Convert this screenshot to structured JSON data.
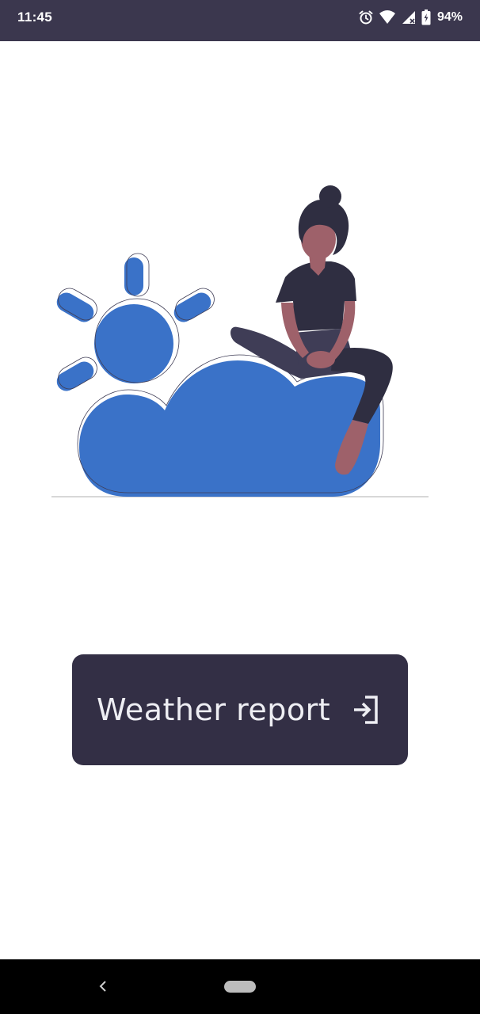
{
  "status_bar": {
    "time": "11:45",
    "battery_percent": "94%",
    "icons": [
      "alarm-icon",
      "wifi-icon",
      "cellular-signal-icon",
      "battery-charging-icon"
    ]
  },
  "illustration": {
    "subject": "weather-illustration",
    "colors": {
      "sun_cloud": "#3a72c8",
      "dark": "#2f2e41",
      "skin": "#9e616a",
      "ground": "#cccccc"
    }
  },
  "button": {
    "label": "Weather report",
    "icon": "login-icon",
    "background": "#332f45"
  },
  "navigation": {
    "back_icon": "back-chevron-icon",
    "home_icon": "home-pill-icon"
  },
  "colors": {
    "status_bar": "#3b374e",
    "page_background": "#ffffff",
    "nav_bar": "#000000"
  }
}
